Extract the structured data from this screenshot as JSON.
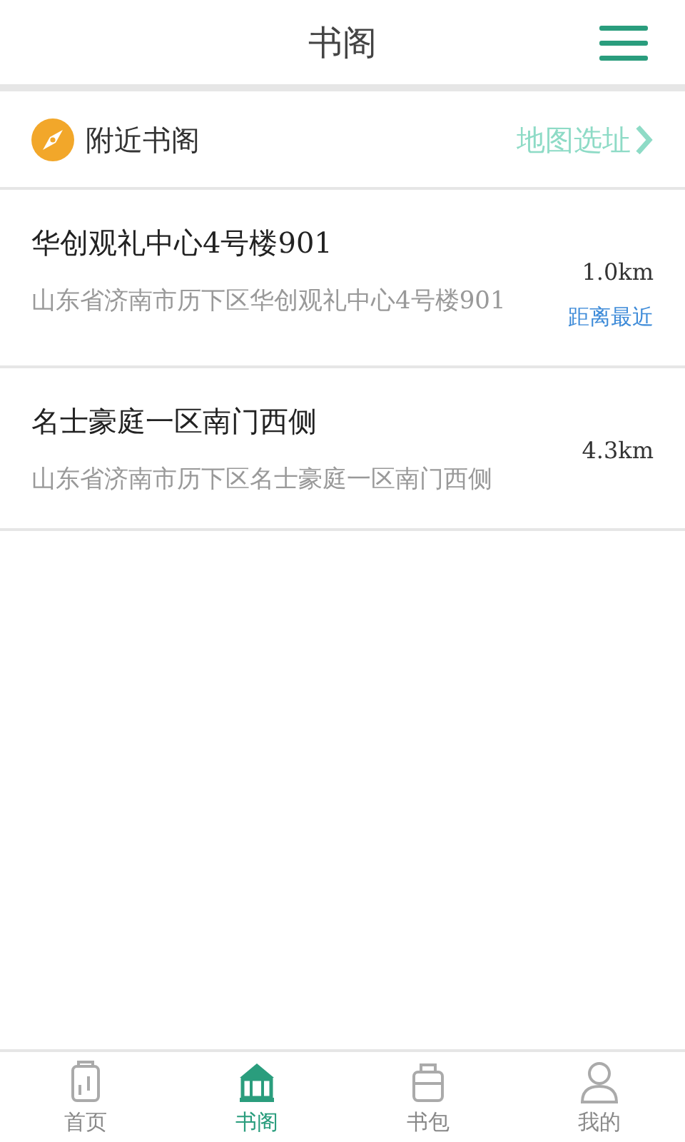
{
  "header": {
    "title": "书阁"
  },
  "nearby": {
    "label": "附近书阁",
    "link": "地图选址"
  },
  "places": [
    {
      "name": "华创观礼中心4号楼901",
      "address": "山东省济南市历下区华创观礼中心4号楼901",
      "distance": "1.0km",
      "tag": "距离最近"
    },
    {
      "name": "名士豪庭一区南门西侧",
      "address": "山东省济南市历下区名士豪庭一区南门西侧",
      "distance": "4.3km"
    }
  ],
  "tabbar": [
    {
      "label": "首页",
      "kind": "home",
      "selected": false
    },
    {
      "label": "书阁",
      "kind": "library",
      "selected": true
    },
    {
      "label": "书包",
      "kind": "bag",
      "selected": false
    },
    {
      "label": "我的",
      "kind": "profile",
      "selected": false
    }
  ]
}
